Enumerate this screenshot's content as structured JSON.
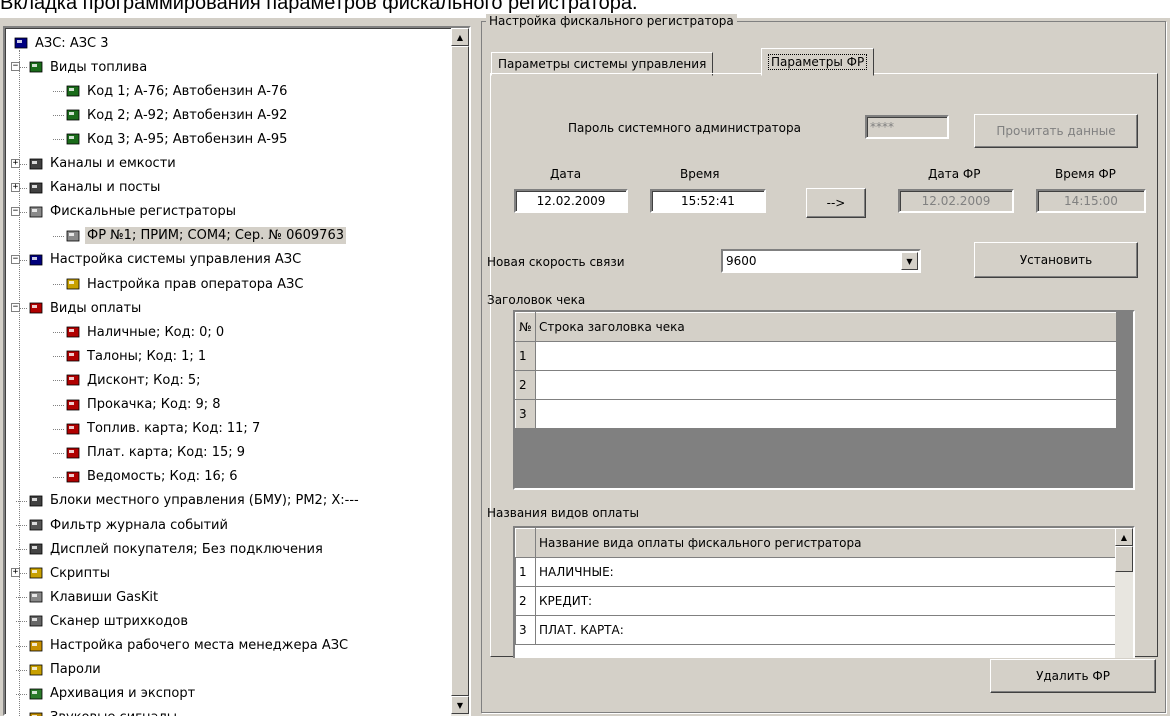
{
  "caption": "Вкладка программирования параметров фискального регистратора.",
  "tree": {
    "nodes": [
      {
        "label": "АЗС: АЗС 3",
        "icon": "station-icon"
      },
      {
        "label": "Виды топлива",
        "icon": "fuel-icon"
      },
      {
        "label": "Код 1; А-76; Автобензин А-76",
        "icon": "fuel-icon"
      },
      {
        "label": "Код 2; А-92; Автобензин А-92",
        "icon": "fuel-icon"
      },
      {
        "label": "Код 3; А-95; Автобензин А-95",
        "icon": "fuel-icon"
      },
      {
        "label": "Каналы и емкости",
        "icon": "channel-icon"
      },
      {
        "label": "Каналы и посты",
        "icon": "channel-icon"
      },
      {
        "label": "Фискальные регистраторы",
        "icon": "register-icon"
      },
      {
        "label": "ФР №1; ПРИМ; COM4; Сер. № 0609763",
        "icon": "register-icon"
      },
      {
        "label": "Настройка системы управления АЗС",
        "icon": "settings-icon"
      },
      {
        "label": "Настройка прав оператора АЗС",
        "icon": "key-icon"
      },
      {
        "label": "Виды оплаты",
        "icon": "payment-icon"
      },
      {
        "label": "Наличные; Код: 0; 0",
        "icon": "payment-icon"
      },
      {
        "label": "Талоны; Код: 1; 1",
        "icon": "payment-icon"
      },
      {
        "label": "Дисконт; Код: 5;",
        "icon": "payment-icon"
      },
      {
        "label": "Прокачка; Код: 9; 8",
        "icon": "payment-icon"
      },
      {
        "label": "Топлив. карта; Код: 11; 7",
        "icon": "payment-icon"
      },
      {
        "label": "Плат. карта; Код: 15; 9",
        "icon": "payment-icon"
      },
      {
        "label": "Ведомость; Код: 16; 6",
        "icon": "payment-icon"
      },
      {
        "label": "Блоки местного управления (БМУ);  РМ2;  X:---",
        "icon": "channel-icon"
      },
      {
        "label": "Фильтр журнала событий",
        "icon": "filter-icon"
      },
      {
        "label": "Дисплей покупателя; Без подключения",
        "icon": "display-icon"
      },
      {
        "label": "Скрипты",
        "icon": "script-icon"
      },
      {
        "label": "Клавиши GasKit",
        "icon": "keyboard-icon"
      },
      {
        "label": "Сканер штрихкодов",
        "icon": "scanner-icon"
      },
      {
        "label": "Настройка рабочего места менеджера АЗС",
        "icon": "workplace-icon"
      },
      {
        "label": "Пароли",
        "icon": "lock-icon"
      },
      {
        "label": "Архивация и экспорт",
        "icon": "archive-icon"
      },
      {
        "label": "Звуковые сигналы",
        "icon": "sound-icon"
      }
    ]
  },
  "group_title": "Настройка фискального регистратора",
  "tabs": [
    "Параметры системы управления",
    "Параметры ФР"
  ],
  "active_tab": "Параметры ФР",
  "form": {
    "admin_password_label": "Пароль системного администратора",
    "admin_password_value": "****",
    "read_button": "Прочитать данные",
    "date_label": "Дата",
    "time_label": "Время",
    "date_value": "12.02.2009",
    "time_value": "15:52:41",
    "arrow_button": "-->",
    "fr_date_label": "Дата ФР",
    "fr_time_label": "Время ФР",
    "fr_date_value": "12.02.2009",
    "fr_time_value": "14:15:00",
    "speed_label": "Новая скорость связи",
    "speed_value": "9600",
    "set_button": "Установить",
    "receipt_header_label": "Заголовок чека",
    "receipt_header_cols": [
      "№",
      "Строка заголовка чека"
    ],
    "receipt_header_rows": [
      "1",
      "2",
      "3"
    ],
    "payment_names_label": "Названия видов оплаты",
    "payment_names_col": "Название вида оплаты фискального регистратора",
    "payment_names_rows": [
      {
        "n": "1",
        "name": "НАЛИЧНЫЕ:"
      },
      {
        "n": "2",
        "name": "КРЕДИТ:"
      },
      {
        "n": "3",
        "name": "ПЛАТ. КАРТА:"
      }
    ]
  },
  "delete_button": "Удалить ФР",
  "colors": {
    "fuel": "#1a6b1a",
    "window": "#d4d0c8",
    "selection": "#d4d0c8"
  }
}
